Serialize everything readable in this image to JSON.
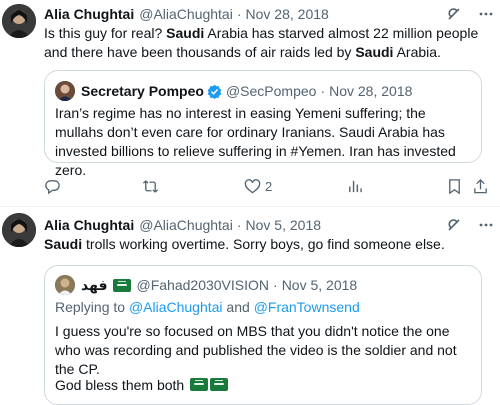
{
  "tweets": [
    {
      "author": {
        "name": "Alia Chughtai",
        "handle": "@AliaChughtai",
        "date": "Nov 28, 2018"
      },
      "text_parts": [
        {
          "t": "Is this guy for real? ",
          "b": false
        },
        {
          "t": "Saudi",
          "b": true
        },
        {
          "t": " Arabia has starved almost 22 million people and there have been thousands of air raids led by ",
          "b": false
        },
        {
          "t": "Saudi",
          "b": true
        },
        {
          "t": " Arabia.",
          "b": false
        }
      ],
      "quote": {
        "author": {
          "name": "Secretary Pompeo",
          "handle": "@SecPompeo",
          "date": "Nov 28, 2018"
        },
        "text": "Iran’s regime has no interest in easing Yemeni suffering; the mullahs don’t even care for ordinary Iranians. Saudi Arabia has invested billions to relieve suffering in #Yemen. Iran has invested zero."
      },
      "actions": {
        "reply": "",
        "retweet": "",
        "like": "2",
        "views": "",
        "bookmark": "",
        "share": ""
      }
    },
    {
      "author": {
        "name": "Alia Chughtai",
        "handle": "@AliaChughtai",
        "date": "Nov 5, 2018"
      },
      "text_parts": [
        {
          "t": "Saudi",
          "b": true
        },
        {
          "t": " trolls working overtime. Sorry boys, go find someone else.",
          "b": false
        }
      ],
      "quote": {
        "author": {
          "name": "فهد",
          "handle": "@Fahad2030VISION",
          "date": "Nov 5, 2018"
        },
        "replying_prefix": "Replying to ",
        "replying_to": [
          "@AliaChughtai",
          "@FranTownsend"
        ],
        "replying_joiner": " and ",
        "text": "I guess you're so focused on MBS that you didn't notice the one who was recording and published the video is the soldier and not the CP.",
        "text2": "God bless them both"
      }
    }
  ],
  "colors": {
    "accent": "#1d9bf0",
    "muted": "#536471",
    "border": "#cfd9de",
    "saudi_green": "#1a7a3c"
  },
  "icons": [
    "grok-icon",
    "more-icon",
    "verified-icon",
    "reply-icon",
    "retweet-icon",
    "like-icon",
    "views-icon",
    "bookmark-icon",
    "share-icon",
    "saudi-flag-icon"
  ]
}
